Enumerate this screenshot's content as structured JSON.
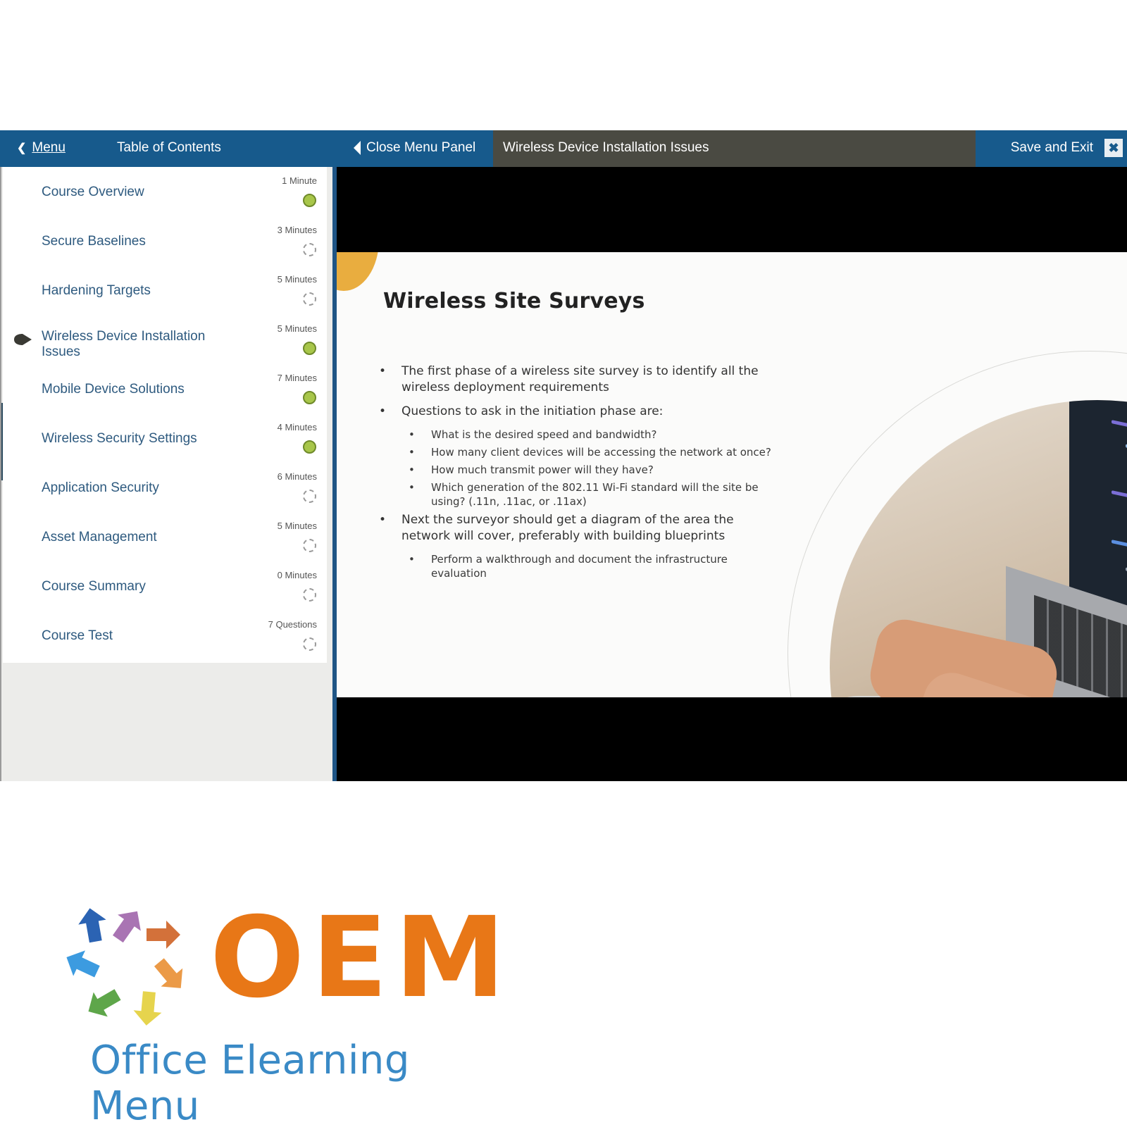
{
  "topbar": {
    "menu_label": "Menu",
    "menu_icon": "chevron-left-icon",
    "toc_label": "Table of Contents",
    "close_panel_label": "Close Menu Panel",
    "close_panel_icon": "caret-left-icon",
    "current_title": "Wireless Device Installation Issues",
    "save_exit_label": "Save and Exit",
    "close_icon_glyph": "✖",
    "colors": {
      "bar_blue": "#175a8c",
      "title_bg": "#4a4a42"
    }
  },
  "toc": {
    "items": [
      {
        "label": "Course Overview",
        "duration": "1 Minute",
        "status": "completed"
      },
      {
        "label": "Secure Baselines",
        "duration": "3 Minutes",
        "status": "not-started"
      },
      {
        "label": "Hardening Targets",
        "duration": "5 Minutes",
        "status": "not-started"
      },
      {
        "label": "Wireless Device Installation Issues",
        "duration": "5 Minutes",
        "status": "completed",
        "current": true
      },
      {
        "label": "Mobile Device Solutions",
        "duration": "7 Minutes",
        "status": "completed"
      },
      {
        "label": "Wireless Security Settings",
        "duration": "4 Minutes",
        "status": "completed"
      },
      {
        "label": "Application Security",
        "duration": "6 Minutes",
        "status": "not-started"
      },
      {
        "label": "Asset Management",
        "duration": "5 Minutes",
        "status": "not-started"
      },
      {
        "label": "Course Summary",
        "duration": "0 Minutes",
        "status": "not-started"
      },
      {
        "label": "Course Test",
        "duration": "7 Questions",
        "status": "not-started"
      }
    ],
    "colors": {
      "completed": "#a8c64a",
      "link": "#2e5a7f"
    }
  },
  "slide": {
    "title": "Wireless Site Surveys",
    "bullets": [
      {
        "text": "The first phase of a wireless site survey is to identify all the wireless deployment requirements",
        "sub": []
      },
      {
        "text": "Questions to ask in the initiation phase are:",
        "sub": [
          "What is the desired speed and bandwidth?",
          "How many client devices will be accessing the network at once?",
          "How much transmit power will they have?",
          "Which generation of the 802.11 Wi-Fi standard will the site be using? (.11n, .11ac, or .11ax)"
        ]
      },
      {
        "text": "Next the surveyor should get a diagram of the area the network will cover, preferably with building blueprints",
        "sub": [
          "Perform a walkthrough and document the infrastructure evaluation"
        ]
      }
    ],
    "image_description": "hands typing on a laptop showing code",
    "accent_color": "#e9ad3f"
  },
  "logo": {
    "wordmark": "OEM",
    "tagline": "Office Elearning Menu",
    "colors": {
      "wordmark": "#e87717",
      "tagline": "#3a8ac6"
    }
  }
}
